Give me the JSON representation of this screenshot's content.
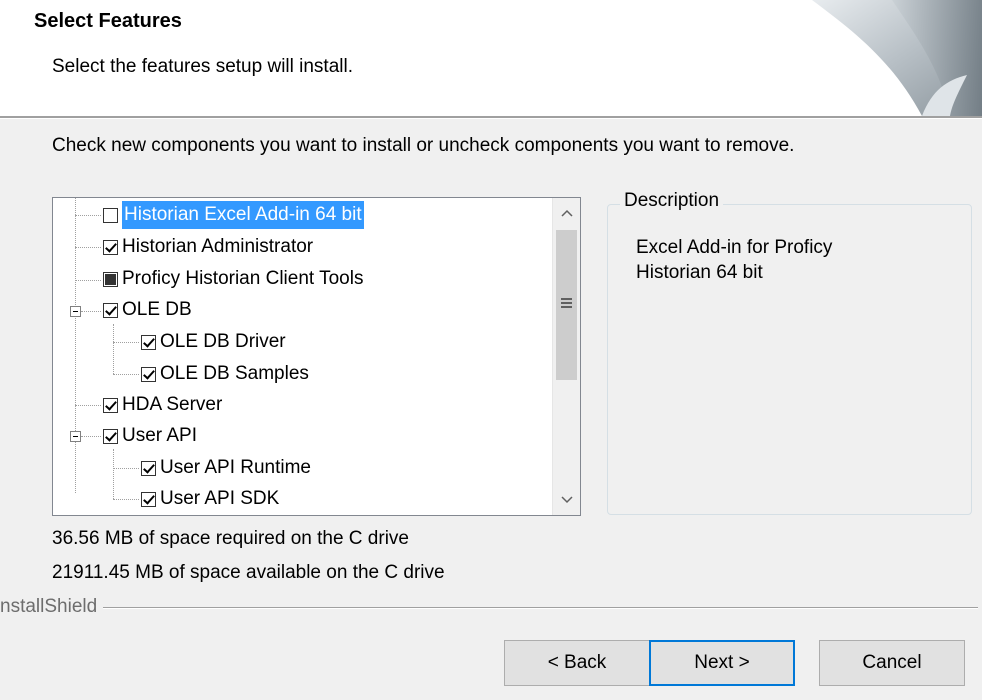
{
  "header": {
    "title": "Select Features",
    "subtitle": "Select the features setup will install."
  },
  "instructions": "Check new components you want to install or uncheck components you want to remove.",
  "tree": {
    "items": [
      {
        "label": "Historian Excel Add-in 64 bit",
        "state": "unchecked",
        "selected": true
      },
      {
        "label": "Historian Administrator",
        "state": "checked"
      },
      {
        "label": "Proficy Historian Client Tools",
        "state": "partial"
      },
      {
        "label": "OLE DB",
        "state": "checked",
        "expanded": true
      },
      {
        "label": "OLE DB Driver",
        "state": "checked"
      },
      {
        "label": "OLE DB Samples",
        "state": "checked"
      },
      {
        "label": "HDA Server",
        "state": "checked"
      },
      {
        "label": "User API",
        "state": "checked",
        "expanded": true
      },
      {
        "label": "User API Runtime",
        "state": "checked"
      },
      {
        "label": "User API  SDK",
        "state": "checked"
      }
    ]
  },
  "description": {
    "legend": "Description",
    "text_line1": "Excel Add-in for Proficy",
    "text_line2": "Historian 64 bit"
  },
  "space": {
    "required": "36.56 MB of space required on the C drive",
    "available": "21911.45 MB of space available on the C drive"
  },
  "installshield_label": "nstallShield",
  "buttons": {
    "back": "< Back",
    "next": "Next >",
    "cancel": "Cancel"
  },
  "colors": {
    "selection": "#3399ff",
    "default_button_border": "#0078d7",
    "dialog_background": "#f0f0f0"
  }
}
